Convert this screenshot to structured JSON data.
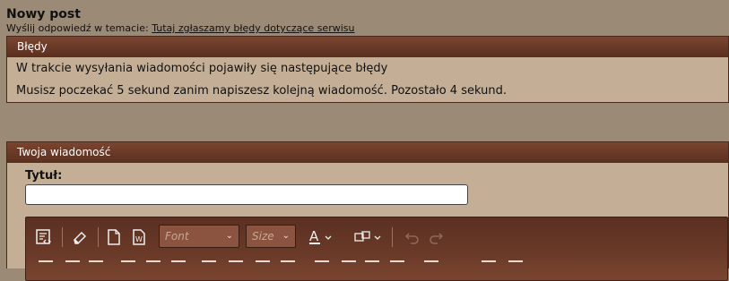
{
  "page": {
    "title": "Nowy post",
    "reply_prefix": "Wyślij odpowiedź w temacie:",
    "reply_topic_link": "Tutaj zgłaszamy błędy dotyczące serwisu"
  },
  "errors_box": {
    "header": "Błędy",
    "lines": [
      "W trakcie wysyłania wiadomości pojawiły się następujące błędy",
      "Musisz poczekać 5 sekund zanim napiszesz kolejną wiadomość. Pozostało 4 sekund."
    ]
  },
  "message_box": {
    "header": "Twoja wiadomość",
    "title_label": "Tytuł:",
    "title_value": ""
  },
  "editor": {
    "font_placeholder": "Font",
    "size_placeholder": "Size",
    "icons": [
      "source-icon",
      "eraser-icon",
      "new-document-icon",
      "paste-word-icon",
      "font-color-icon",
      "special-insert-icon",
      "undo-icon",
      "redo-icon"
    ]
  },
  "colors": {
    "background": "#9b8a76",
    "panel": "#c4af96",
    "header_dark": "#5a2f1f"
  }
}
